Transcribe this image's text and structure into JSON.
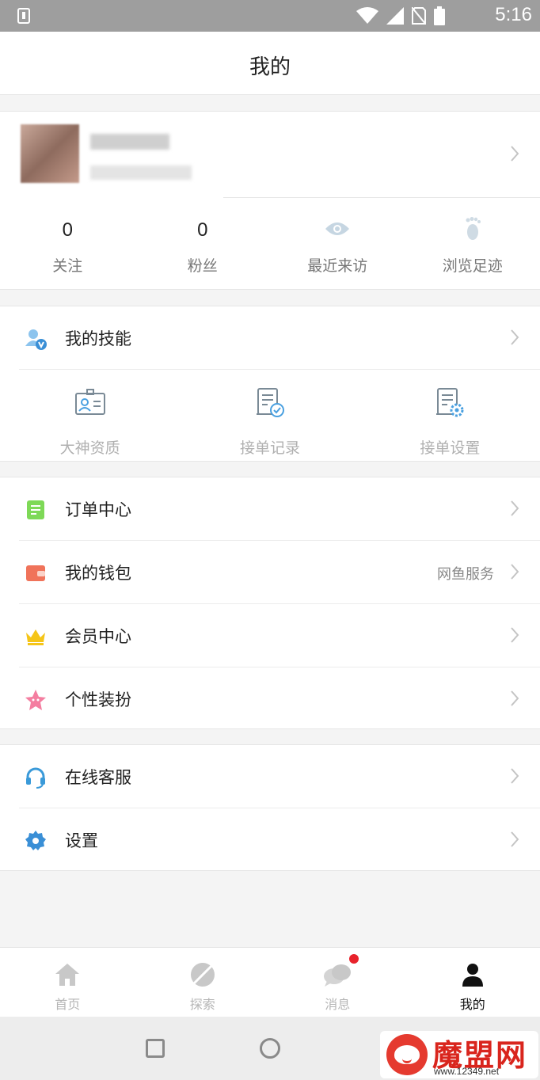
{
  "status_bar": {
    "time": "5:16"
  },
  "header": {
    "title": "我的"
  },
  "profile": {
    "stats": [
      {
        "value": "0",
        "label": "关注"
      },
      {
        "value": "0",
        "label": "粉丝"
      },
      {
        "icon": "eye-icon",
        "label": "最近来访"
      },
      {
        "icon": "footprint-icon",
        "label": "浏览足迹"
      }
    ]
  },
  "skills": {
    "label": "我的技能",
    "items": [
      {
        "icon": "id-card-icon",
        "label": "大神资质"
      },
      {
        "icon": "doc-check-icon",
        "label": "接单记录"
      },
      {
        "icon": "doc-gear-icon",
        "label": "接单设置"
      }
    ]
  },
  "menu_group_1": [
    {
      "icon": "order-icon",
      "label": "订单中心",
      "right": ""
    },
    {
      "icon": "wallet-icon",
      "label": "我的钱包",
      "right": "网鱼服务"
    },
    {
      "icon": "crown-icon",
      "label": "会员中心",
      "right": ""
    },
    {
      "icon": "star-icon",
      "label": "个性装扮",
      "right": ""
    }
  ],
  "menu_group_2": [
    {
      "icon": "headset-icon",
      "label": "在线客服"
    },
    {
      "icon": "gear-icon",
      "label": "设置"
    }
  ],
  "tabbar": [
    {
      "icon": "home-icon",
      "label": "首页"
    },
    {
      "icon": "explore-icon",
      "label": "探索"
    },
    {
      "icon": "chat-icon",
      "label": "消息"
    },
    {
      "icon": "person-icon",
      "label": "我的"
    }
  ],
  "watermark": {
    "text": "魔盟网",
    "url": "www.12349.net"
  },
  "colors": {
    "accent_blue": "#3a9ad9",
    "green": "#7ed957",
    "wallet": "#f0735a",
    "crown": "#f5c518",
    "pink": "#f47ea0",
    "badge": "#e8222b"
  }
}
